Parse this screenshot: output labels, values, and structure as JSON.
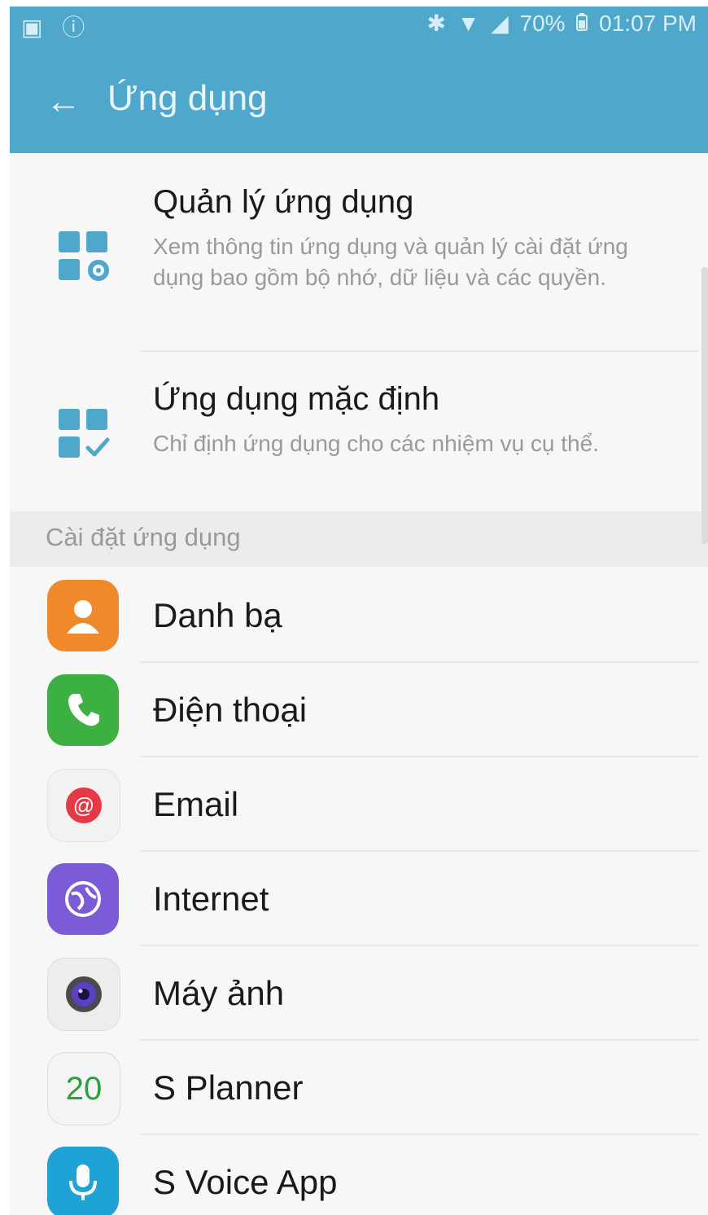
{
  "status_bar": {
    "left_icons": [
      "▣",
      "ⓘ"
    ],
    "right_icons": [
      "✱",
      "▼",
      "◢"
    ],
    "battery": "70%",
    "time": "01:07 PM"
  },
  "header": {
    "title": "Ứng dụng"
  },
  "items": [
    {
      "title": "Quản lý ứng dụng",
      "desc": "Xem thông tin ứng dụng và quản lý cài đặt ứng dụng bao gồm bộ nhớ, dữ liệu và các quyền."
    },
    {
      "title": "Ứng dụng mặc định",
      "desc": "Chỉ định ứng dụng cho các nhiệm vụ cụ thể."
    }
  ],
  "section_header": "Cài đặt ứng dụng",
  "apps": [
    {
      "label": "Danh bạ",
      "icon": "contact-icon",
      "color": "#f0892a"
    },
    {
      "label": "Điện thoại",
      "icon": "phone-icon",
      "color": "#3cb043"
    },
    {
      "label": "Email",
      "icon": "email-icon",
      "color": "#e63946"
    },
    {
      "label": "Internet",
      "icon": "internet-icon",
      "color": "#7b5cd6"
    },
    {
      "label": "Máy ảnh",
      "icon": "camera-icon",
      "color": "#5b3fc4"
    },
    {
      "label": "S Planner",
      "icon": "calendar-icon",
      "color": "#2e9e3f",
      "badge": "20"
    },
    {
      "label": "S Voice App",
      "icon": "microphone-icon",
      "color": "#1fa3d6"
    }
  ],
  "colors": {
    "appbar": "#4fa8cc",
    "accent": "#4fa8cc"
  }
}
